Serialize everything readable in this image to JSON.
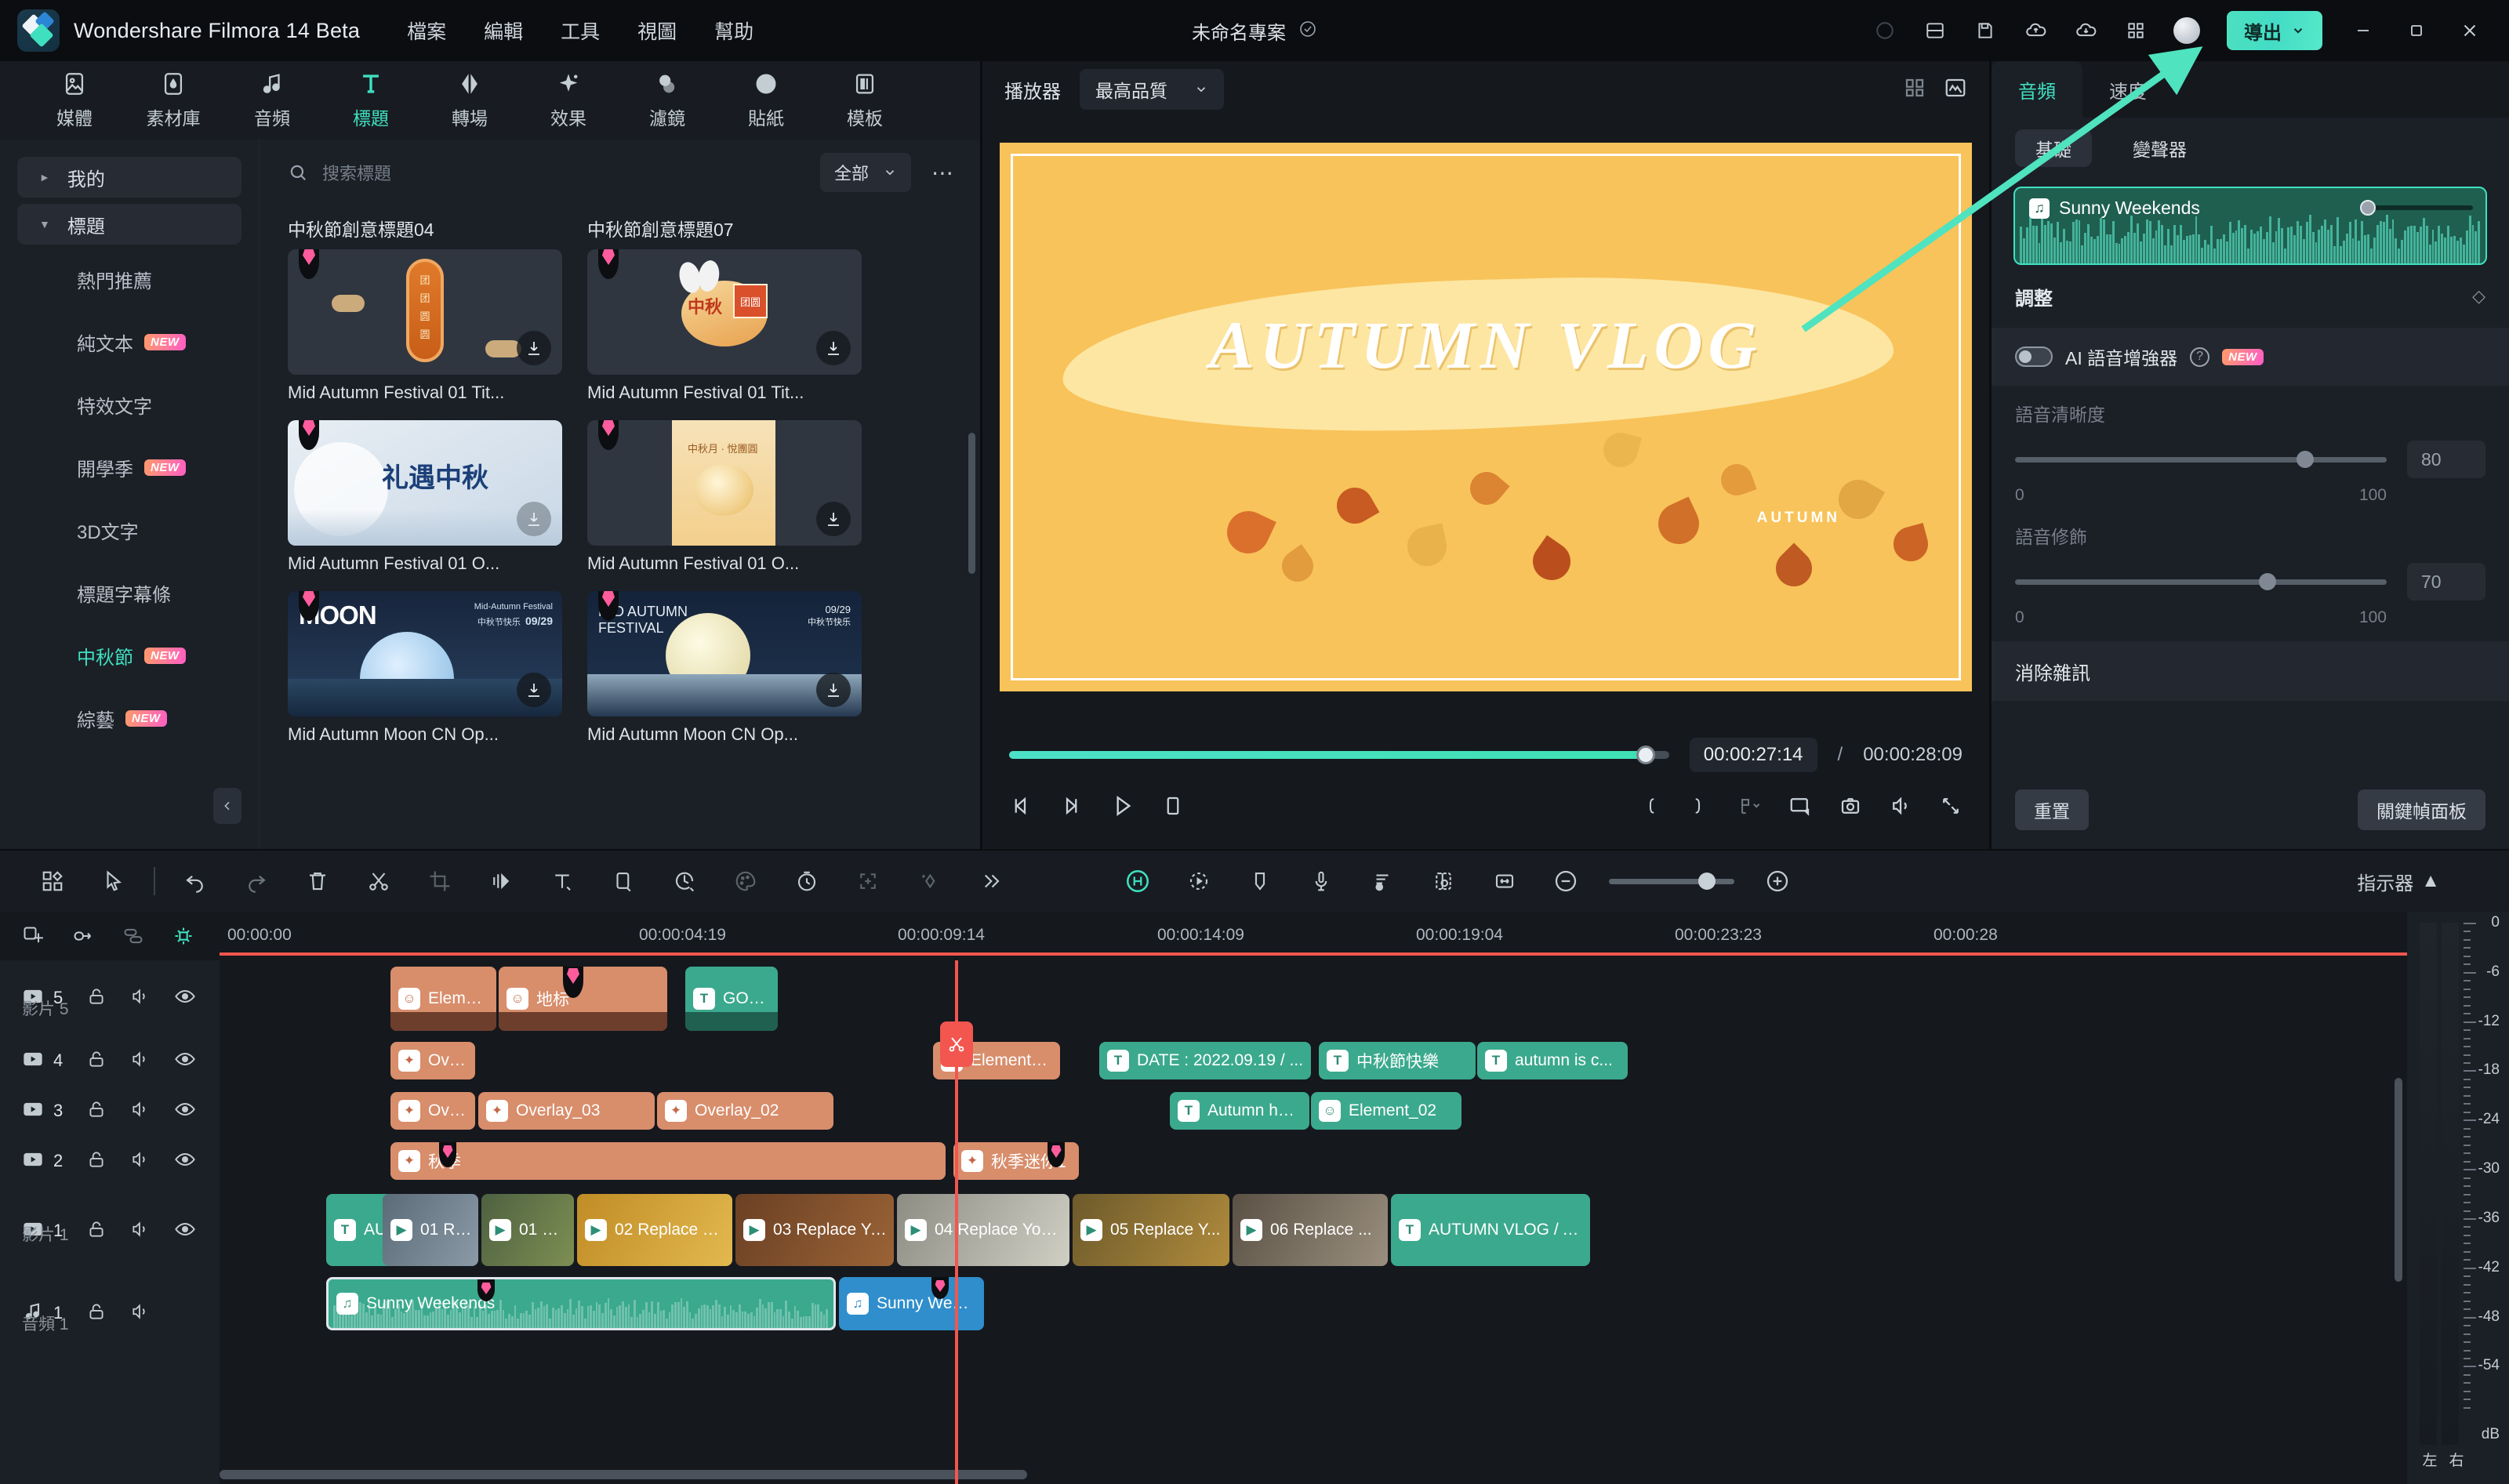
{
  "titlebar": {
    "app_name": "Wondershare Filmora 14 Beta",
    "menus": [
      "檔案",
      "編輯",
      "工具",
      "視圖",
      "幫助"
    ],
    "project_name": "未命名專案",
    "export_label": "導出",
    "icons": [
      "circle-icon",
      "layout-icon",
      "save-icon",
      "cloud-upload-icon",
      "cloud-download-icon",
      "apps-grid-icon"
    ],
    "window_buttons": [
      "minimize",
      "maximize",
      "close"
    ],
    "accent": "#4ce0c0"
  },
  "toolbar_tabs": [
    {
      "label": "媒體",
      "icon": "media-icon",
      "active": false
    },
    {
      "label": "素材庫",
      "icon": "stock-icon",
      "active": false
    },
    {
      "label": "音頻",
      "icon": "audio-icon",
      "active": false
    },
    {
      "label": "標題",
      "icon": "title-icon",
      "active": true
    },
    {
      "label": "轉場",
      "icon": "transition-icon",
      "active": false
    },
    {
      "label": "效果",
      "icon": "effects-icon",
      "active": false
    },
    {
      "label": "濾鏡",
      "icon": "filter-icon",
      "active": false
    },
    {
      "label": "貼紙",
      "icon": "sticker-icon",
      "active": false
    },
    {
      "label": "模板",
      "icon": "template-icon",
      "active": false
    }
  ],
  "left_panel": {
    "groups": [
      {
        "label": "我的",
        "expanded": false
      },
      {
        "label": "標題",
        "expanded": true
      }
    ],
    "items": [
      {
        "label": "熱門推薦",
        "badge": "",
        "active": false
      },
      {
        "label": "純文本",
        "badge": "NEW",
        "active": false
      },
      {
        "label": "特效文字",
        "badge": "",
        "active": false
      },
      {
        "label": "開學季",
        "badge": "NEW",
        "active": false
      },
      {
        "label": "3D文字",
        "badge": "",
        "active": false
      },
      {
        "label": "標題字幕條",
        "badge": "",
        "active": false
      },
      {
        "label": "中秋節",
        "badge": "NEW",
        "active": true
      },
      {
        "label": "綜藝",
        "badge": "NEW",
        "active": false
      }
    ],
    "search_placeholder": "搜索標題",
    "filter_label": "全部",
    "grid": [
      {
        "section": "中秋節創意標題04",
        "cards": [
          {
            "name": "Mid Autumn Festival 01 Tit...",
            "pinned": true
          },
          {
            "name": "Mid Autumn Festival 01 O...",
            "pinned": true
          },
          {
            "name": "Mid Autumn Moon CN Op...",
            "pinned": true
          }
        ]
      },
      {
        "section": "中秋節創意標題07",
        "cards": [
          {
            "name": "Mid Autumn Festival 01 Tit...",
            "pinned": true
          },
          {
            "name": "Mid Autumn Festival 01 O...",
            "pinned": true
          },
          {
            "name": "Mid Autumn Moon CN Op...",
            "pinned": true
          }
        ]
      }
    ]
  },
  "preview": {
    "player_label": "播放器",
    "quality_label": "最高品質",
    "title_text": "AUTUMN VLOG",
    "watermark_text": "AUTUMN",
    "current_time": "00:00:27:14",
    "time_separator": "/",
    "total_time": "00:00:28:09",
    "controls": [
      "prev-frame-icon",
      "next-frame-icon",
      "play-icon",
      "stop-icon"
    ],
    "right_controls": [
      "mark-in-icon",
      "mark-out-icon",
      "snapshot-dropdown-icon",
      "screen-icon",
      "camera-icon",
      "volume-icon",
      "fullscreen-icon"
    ]
  },
  "right_panel": {
    "tabs": [
      {
        "label": "音頻",
        "active": true
      },
      {
        "label": "速度",
        "active": false
      }
    ],
    "subtabs": [
      {
        "label": "基礎",
        "active": true
      },
      {
        "label": "變聲器",
        "active": false
      }
    ],
    "audio_clip_name": "Sunny Weekends",
    "adjust_label": "調整",
    "ai_toggle_label": "AI 語音增強器",
    "ai_toggle_badge": "NEW",
    "ai_toggle_on": false,
    "sliders": [
      {
        "label": "語音清晰度",
        "value": "80",
        "min": "0",
        "max": "100",
        "percent": 78
      },
      {
        "label": "語音修飾",
        "value": "70",
        "min": "0",
        "max": "100",
        "percent": 68
      }
    ],
    "noise_section_label": "消除雜訊",
    "reset_label": "重置",
    "keyframe_label": "關鍵幀面板"
  },
  "timeline": {
    "toolbar_icons": [
      "apps-icon",
      "select-tool-icon",
      "undo-icon",
      "redo-icon",
      "delete-icon",
      "split-icon",
      "crop-icon",
      "audio-detach-icon",
      "text-icon",
      "rect-mask-icon",
      "speed-icon",
      "color-icon",
      "duration-icon",
      "auto-reframe-icon",
      "keyframe-icon",
      "more-icon"
    ],
    "right_icons": [
      "ai-tools-icon",
      "motion-tracking-icon",
      "marker-icon",
      "mic-record-icon",
      "audio-ducking-icon",
      "render-preview-icon",
      "fit-timeline-icon"
    ],
    "zoom_out_icon": "zoom-out-icon",
    "zoom_in_icon": "zoom-in-icon",
    "meter_label": "指示器",
    "head_icons": [
      "add-track-icon",
      "link-icon",
      "merge-icon",
      "magnet-icon"
    ],
    "ruler_ticks": [
      "00:00:00",
      "00:00:04:19",
      "00:00:09:14",
      "00:00:14:09",
      "00:00:19:04",
      "00:00:23:23",
      "00:00:28"
    ],
    "tracks": [
      {
        "num": "5",
        "name": "影片 5",
        "type": "video"
      },
      {
        "num": "4",
        "name": "",
        "type": "video"
      },
      {
        "num": "3",
        "name": "",
        "type": "video"
      },
      {
        "num": "2",
        "name": "",
        "type": "video"
      },
      {
        "num": "1",
        "name": "影片 1",
        "type": "video"
      },
      {
        "num": "1",
        "name": "音頻 1",
        "type": "audio"
      }
    ],
    "clips": {
      "track5": [
        {
          "label": "Element...",
          "kind": "elem"
        },
        {
          "label": "地标",
          "kind": "elem"
        },
        {
          "label": "GOLDE...",
          "kind": "text"
        }
      ],
      "track4": [
        {
          "label": "Overlay...",
          "kind": "elem"
        },
        {
          "label": "Element_0(",
          "kind": "elem"
        },
        {
          "label": "DATE : 2022.09.19 / ...",
          "kind": "text"
        },
        {
          "label": "中秋節快樂",
          "kind": "text"
        },
        {
          "label": "autumn is c...",
          "kind": "text"
        }
      ],
      "track3": [
        {
          "label": "Overlay...",
          "kind": "elem"
        },
        {
          "label": "Overlay_03",
          "kind": "elem"
        },
        {
          "label": "Overlay_02",
          "kind": "elem"
        },
        {
          "label": "Autumn has ...",
          "kind": "text"
        },
        {
          "label": "Element_02",
          "kind": "text"
        }
      ],
      "track2": [
        {
          "label": "秋季",
          "kind": "elem"
        },
        {
          "label": "秋季迷你1",
          "kind": "elem"
        }
      ],
      "track1": [
        {
          "label": "AUTUMN /",
          "kind": "text"
        },
        {
          "label": "01 Repl...",
          "kind": "media"
        },
        {
          "label": "02 Replace You...",
          "kind": "media"
        },
        {
          "label": "03 Replace Your ...",
          "kind": "media"
        },
        {
          "label": "04 Replace Your Video",
          "kind": "media"
        },
        {
          "label": "05 Replace Y...",
          "kind": "media"
        },
        {
          "label": "06 Replace ...",
          "kind": "media"
        },
        {
          "label": "AUTUMN VLOG / A...",
          "kind": "text"
        }
      ],
      "audio1": [
        {
          "label": "Sunny Weekends",
          "kind": "audio"
        },
        {
          "label": "Sunny Weekends",
          "kind": "audio"
        }
      ]
    },
    "meter": {
      "levels": [
        "0",
        "-6",
        "-12",
        "-18",
        "-24",
        "-30",
        "-36",
        "-42",
        "-48",
        "-54"
      ],
      "unit": "dB",
      "channels": [
        "左",
        "右"
      ]
    }
  }
}
